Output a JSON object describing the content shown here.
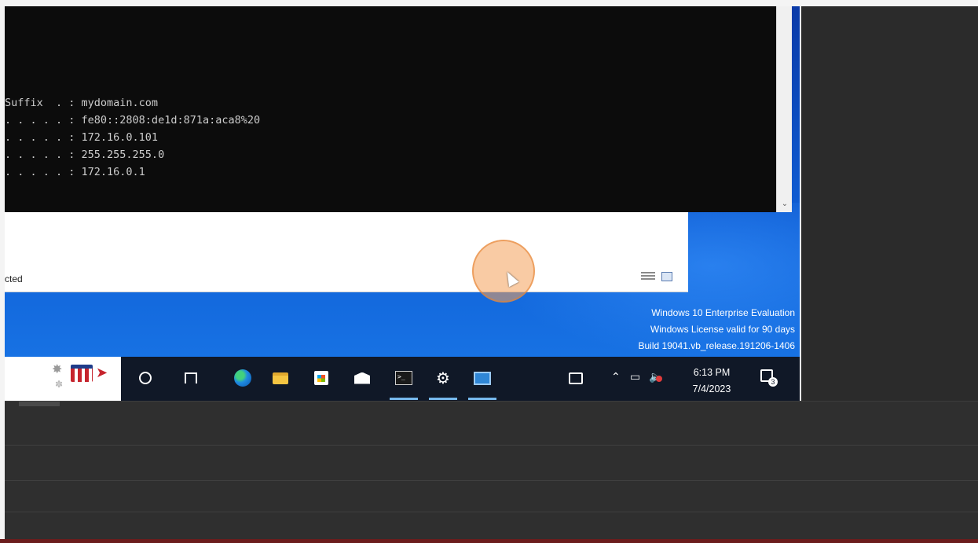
{
  "console": {
    "lines": [
      "Suffix  . : mydomain.com",
      ". . . . . : fe80::2808:de1d:871a:aca8%20",
      ". . . . . : 172.16.0.101",
      ". . . . . : 255.255.255.0",
      ". . . . . : 172.16.0.1"
    ]
  },
  "explorer": {
    "status_text": "cted"
  },
  "watermark": {
    "line1": "Windows 10 Enterprise Evaluation",
    "line2": "Windows License valid for 90 days",
    "line3": "Build 19041.vb_release.191206-1406"
  },
  "taskbar": {
    "time": "6:13 PM",
    "date": "7/4/2023",
    "notification_count": "3",
    "icons": [
      "cortana-icon",
      "task-view-icon",
      "edge-icon",
      "file-explorer-icon",
      "store-icon",
      "mail-icon",
      "command-prompt-icon",
      "settings-gear-icon",
      "remote-desktop-icon"
    ],
    "tray": [
      "news-icon",
      "chevron-up-icon",
      "network-icon",
      "volume-muted-icon"
    ]
  },
  "colors": {
    "desktop": "#0f5fd6",
    "taskbar": "#101827",
    "console": "#0c0c0c",
    "cursor_halo": "#f4a15a"
  }
}
